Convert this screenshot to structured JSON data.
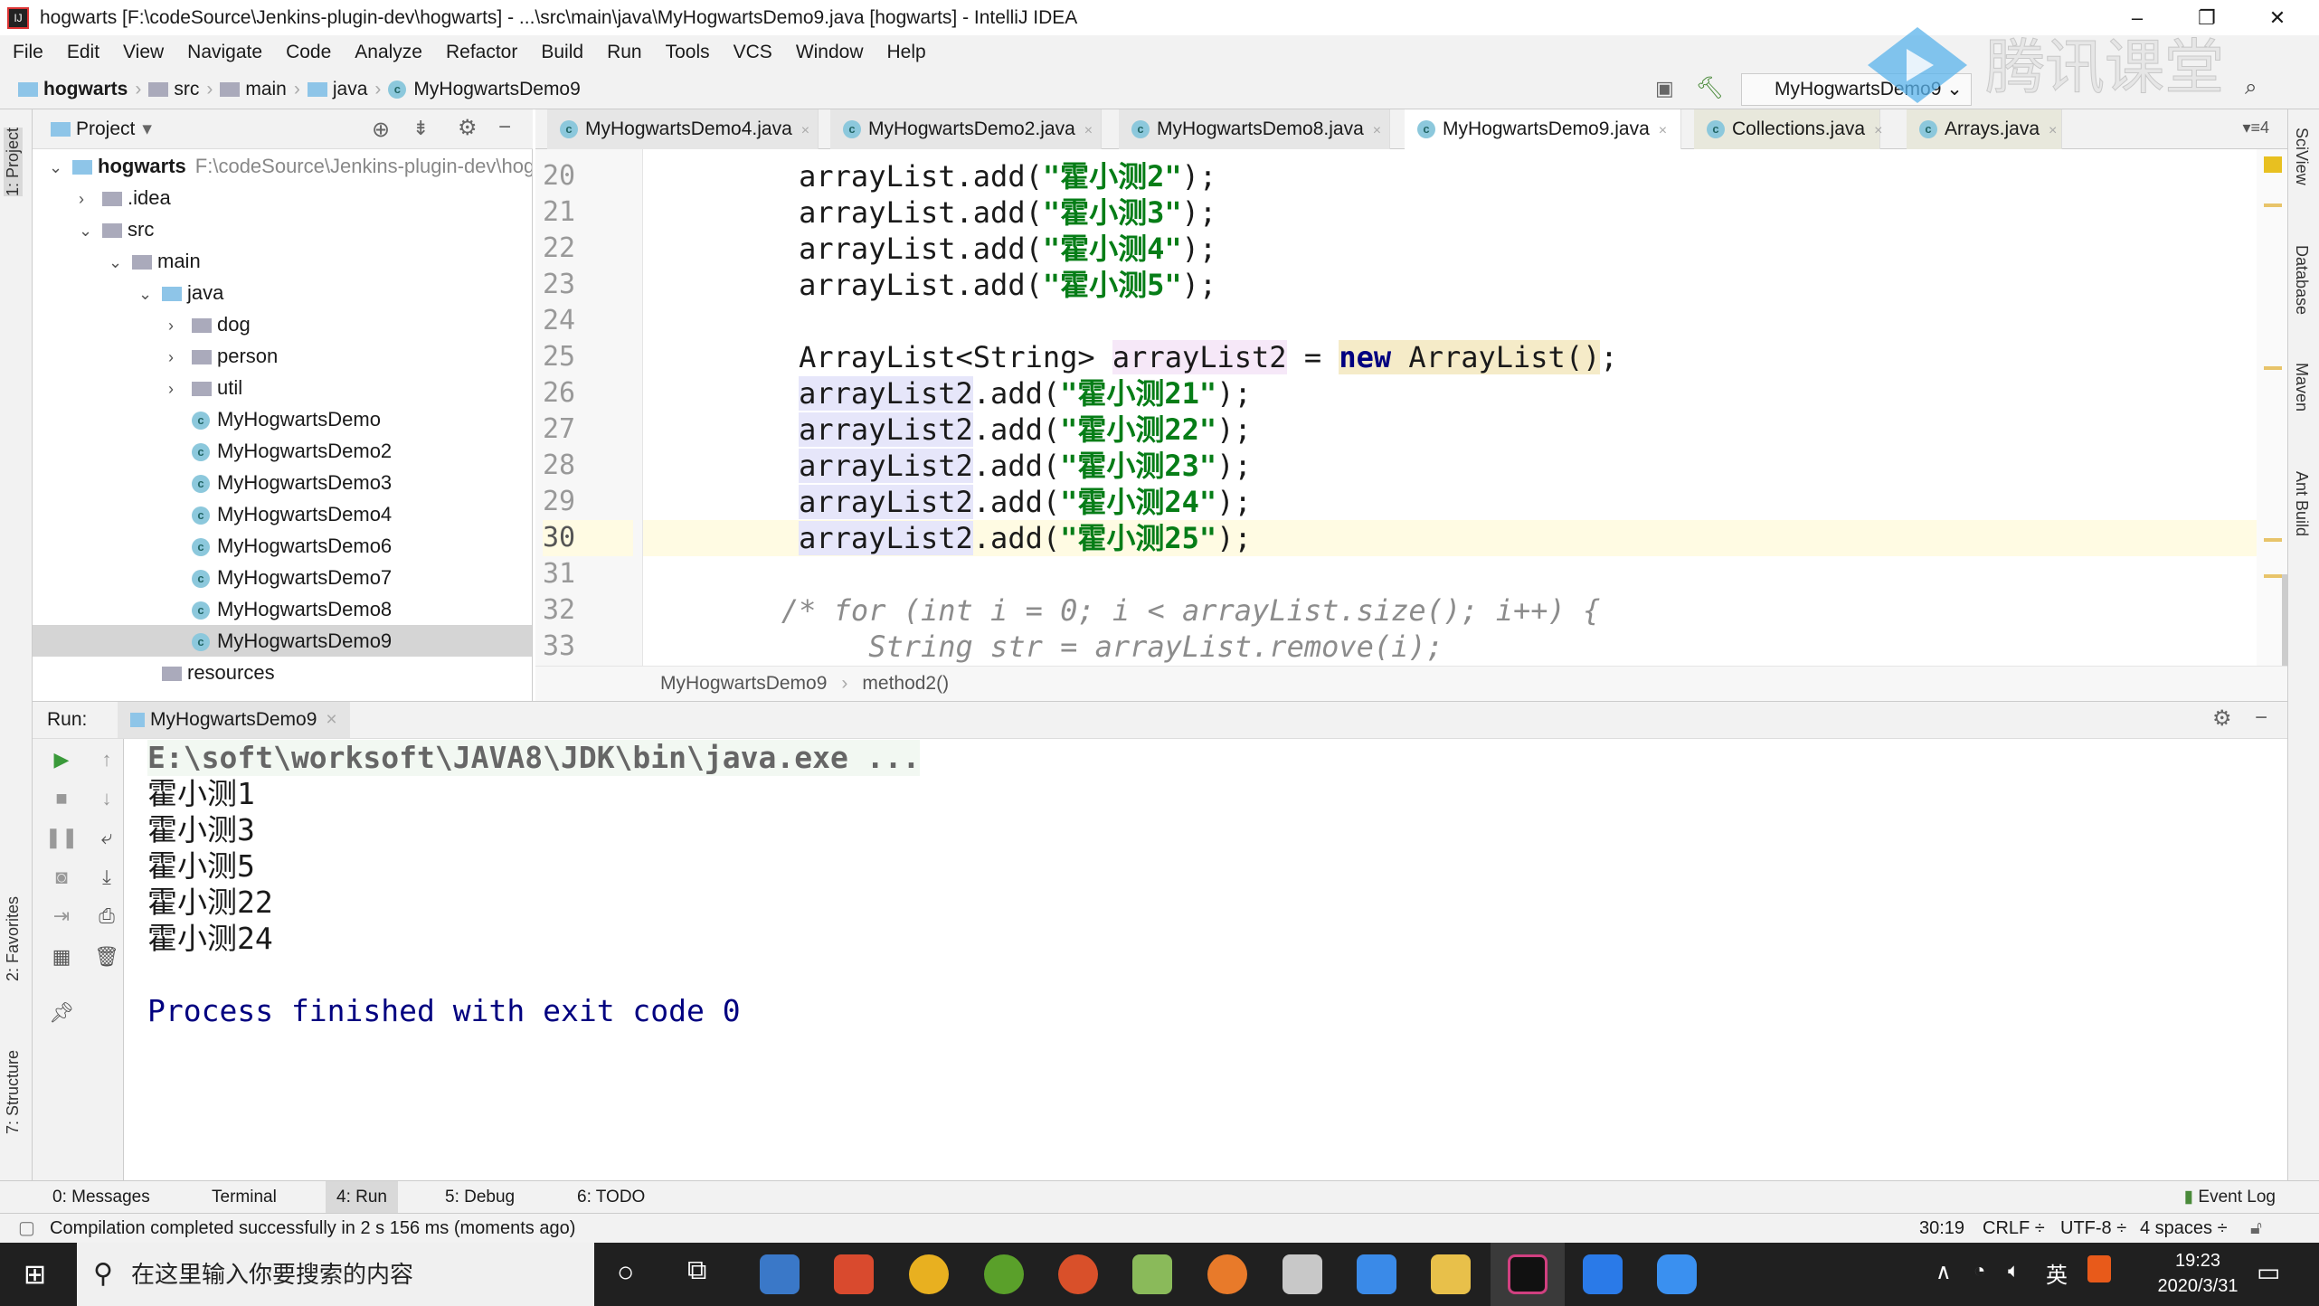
{
  "window": {
    "title": "hogwarts [F:\\codeSource\\Jenkins-plugin-dev\\hogwarts] - ...\\src\\main\\java\\MyHogwartsDemo9.java [hogwarts] - IntelliJ IDEA",
    "minimize": "–",
    "maximize": "❐",
    "close": "✕"
  },
  "menu": [
    "File",
    "Edit",
    "View",
    "Navigate",
    "Code",
    "Analyze",
    "Refactor",
    "Build",
    "Run",
    "Tools",
    "VCS",
    "Window",
    "Help"
  ],
  "nav": {
    "crumbs": [
      "hogwarts",
      "src",
      "main",
      "java",
      "MyHogwartsDemo9"
    ],
    "run_config": "MyHogwartsDemo9"
  },
  "watermark_logo": "腾讯课堂",
  "left_stripe": {
    "project": "1: Project",
    "favorites": "2: Favorites",
    "structure": "7: Structure"
  },
  "right_stripe": [
    "SciView",
    "Database",
    "Maven",
    "Ant Build"
  ],
  "project": {
    "title": "Project",
    "tree": [
      {
        "label": "hogwarts",
        "hint": "F:\\codeSource\\Jenkins-plugin-dev\\hog",
        "level": 0,
        "expanded": true,
        "icon": "module-folder",
        "bold": true
      },
      {
        "label": ".idea",
        "level": 1,
        "expanded": false,
        "icon": "folder"
      },
      {
        "label": "src",
        "level": 1,
        "expanded": true,
        "icon": "folder"
      },
      {
        "label": "main",
        "level": 2,
        "expanded": true,
        "icon": "folder"
      },
      {
        "label": "java",
        "level": 3,
        "expanded": true,
        "icon": "source-folder"
      },
      {
        "label": "dog",
        "level": 4,
        "expanded": false,
        "icon": "package"
      },
      {
        "label": "person",
        "level": 4,
        "expanded": false,
        "icon": "package"
      },
      {
        "label": "util",
        "level": 4,
        "expanded": false,
        "icon": "package"
      },
      {
        "label": "MyHogwartsDemo",
        "level": 4,
        "icon": "class"
      },
      {
        "label": "MyHogwartsDemo2",
        "level": 4,
        "icon": "class"
      },
      {
        "label": "MyHogwartsDemo3",
        "level": 4,
        "icon": "class"
      },
      {
        "label": "MyHogwartsDemo4",
        "level": 4,
        "icon": "class"
      },
      {
        "label": "MyHogwartsDemo6",
        "level": 4,
        "icon": "class"
      },
      {
        "label": "MyHogwartsDemo7",
        "level": 4,
        "icon": "class"
      },
      {
        "label": "MyHogwartsDemo8",
        "level": 4,
        "icon": "class"
      },
      {
        "label": "MyHogwartsDemo9",
        "level": 4,
        "icon": "class",
        "selected": true
      },
      {
        "label": "resources",
        "level": 3,
        "icon": "resources-folder"
      }
    ]
  },
  "editor_tabs": [
    {
      "label": "MyHogwartsDemo4.java"
    },
    {
      "label": "MyHogwartsDemo2.java"
    },
    {
      "label": "MyHogwartsDemo8.java"
    },
    {
      "label": "MyHogwartsDemo9.java",
      "active": true
    },
    {
      "label": "Collections.java",
      "library": true
    },
    {
      "label": "Arrays.java",
      "library": true
    }
  ],
  "tabs_overflow": "▾≡4",
  "code": [
    {
      "n": "20",
      "tokens": [
        {
          "t": "        arrayList.add("
        },
        {
          "t": "\"霍小测2\"",
          "c": "str"
        },
        {
          "t": ");"
        }
      ]
    },
    {
      "n": "21",
      "tokens": [
        {
          "t": "        arrayList.add("
        },
        {
          "t": "\"霍小测3\"",
          "c": "str"
        },
        {
          "t": ");"
        }
      ]
    },
    {
      "n": "22",
      "tokens": [
        {
          "t": "        arrayList.add("
        },
        {
          "t": "\"霍小测4\"",
          "c": "str"
        },
        {
          "t": ");"
        }
      ]
    },
    {
      "n": "23",
      "tokens": [
        {
          "t": "        arrayList.add("
        },
        {
          "t": "\"霍小测5\"",
          "c": "str"
        },
        {
          "t": ");"
        }
      ]
    },
    {
      "n": "24",
      "tokens": [
        {
          "t": ""
        }
      ]
    },
    {
      "n": "25",
      "tokens": [
        {
          "t": "        ArrayList<String> "
        },
        {
          "t": "arrayList2",
          "c": "decl"
        },
        {
          "t": " = "
        },
        {
          "t": "new",
          "c": "kw"
        },
        {
          "t": " ArrayList()",
          "c": "hl"
        },
        {
          "t": ";"
        }
      ]
    },
    {
      "n": "26",
      "tokens": [
        {
          "t": "        "
        },
        {
          "t": "arrayList2",
          "c": "ref"
        },
        {
          "t": ".add("
        },
        {
          "t": "\"霍小测21\"",
          "c": "str"
        },
        {
          "t": ");"
        }
      ]
    },
    {
      "n": "27",
      "tokens": [
        {
          "t": "        "
        },
        {
          "t": "arrayList2",
          "c": "ref"
        },
        {
          "t": ".add("
        },
        {
          "t": "\"霍小测22\"",
          "c": "str"
        },
        {
          "t": ");"
        }
      ]
    },
    {
      "n": "28",
      "tokens": [
        {
          "t": "        "
        },
        {
          "t": "arrayList2",
          "c": "ref"
        },
        {
          "t": ".add("
        },
        {
          "t": "\"霍小测23\"",
          "c": "str"
        },
        {
          "t": ");"
        }
      ]
    },
    {
      "n": "29",
      "tokens": [
        {
          "t": "        "
        },
        {
          "t": "arrayList2",
          "c": "ref"
        },
        {
          "t": ".add("
        },
        {
          "t": "\"霍小测24\"",
          "c": "str"
        },
        {
          "t": ");"
        }
      ]
    },
    {
      "n": "30",
      "current": true,
      "tokens": [
        {
          "t": "        "
        },
        {
          "t": "arrayList2",
          "c": "ref"
        },
        {
          "t": ".add("
        },
        {
          "t": "\"霍小测25\"",
          "c": "str"
        },
        {
          "t": ");"
        }
      ]
    },
    {
      "n": "31",
      "tokens": [
        {
          "t": ""
        }
      ]
    },
    {
      "n": "32",
      "tokens": [
        {
          "t": "       /* for (int i = 0; i < arrayList.size(); i++) {",
          "c": "cmt"
        }
      ]
    },
    {
      "n": "33",
      "tokens": [
        {
          "t": "            String str = arrayList.remove(i);",
          "c": "cmt"
        }
      ]
    }
  ],
  "editor_breadcrumb": [
    "MyHogwartsDemo9",
    "method2()"
  ],
  "run": {
    "label": "Run:",
    "tab": "MyHogwartsDemo9",
    "output": [
      {
        "t": "E:\\soft\\worksoft\\JAVA8\\JDK\\bin\\java.exe ...",
        "c": "cmd"
      },
      {
        "t": "霍小测1"
      },
      {
        "t": "霍小测3"
      },
      {
        "t": "霍小测5"
      },
      {
        "t": "霍小测22"
      },
      {
        "t": "霍小测24"
      },
      {
        "t": ""
      },
      {
        "t": "Process finished with exit code 0",
        "c": "exit"
      }
    ]
  },
  "tool_tabs": [
    {
      "label": "0: Messages"
    },
    {
      "label": "Terminal"
    },
    {
      "label": "4: Run",
      "active": true
    },
    {
      "label": "5: Debug"
    },
    {
      "label": "6: TODO"
    }
  ],
  "event_log": "Event Log",
  "status": {
    "message": "Compilation completed successfully in 2 s 156 ms (moments ago)",
    "position": "30:19",
    "line_sep": "CRLF ÷",
    "encoding": "UTF-8 ÷",
    "indent": "4 spaces ÷"
  },
  "taskbar": {
    "search_placeholder": "在这里输入你要搜索的内容",
    "ime": "英",
    "time": "19:23",
    "date": "2020/3/31"
  }
}
